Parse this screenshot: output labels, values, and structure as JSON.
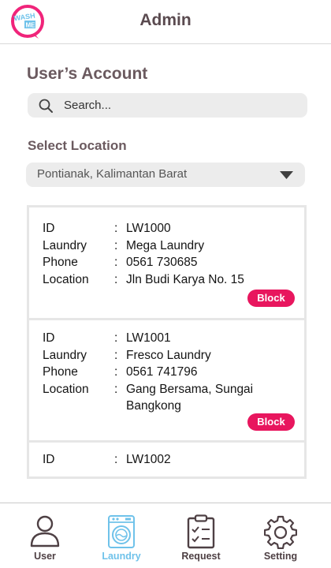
{
  "header": {
    "title": "Admin",
    "logo_text": [
      "WASH",
      "ME"
    ]
  },
  "page": {
    "section_title": "User’s Account"
  },
  "search": {
    "placeholder": "Search..."
  },
  "location": {
    "label": "Select Location",
    "selected": "Pontianak, Kalimantan Barat"
  },
  "field_labels": {
    "id": "ID",
    "laundry": "Laundry",
    "phone": "Phone",
    "location": "Location",
    "colon": ":"
  },
  "accounts": [
    {
      "id": "LW1000",
      "laundry": "Mega Laundry",
      "phone": "0561 730685",
      "location": "Jln Budi Karya No. 15",
      "action_label": "Block"
    },
    {
      "id": "LW1001",
      "laundry": "Fresco Laundry",
      "phone": "0561 741796",
      "location": "Gang Bersama, Sungai Bangkong",
      "action_label": "Block"
    },
    {
      "id": "LW1002"
    }
  ],
  "nav": {
    "items": [
      {
        "label": "User",
        "icon": "user-icon",
        "active": false
      },
      {
        "label": "Laundry",
        "icon": "washing-machine-icon",
        "active": true
      },
      {
        "label": "Request",
        "icon": "clipboard-check-icon",
        "active": false
      },
      {
        "label": "Setting",
        "icon": "gear-icon",
        "active": false
      }
    ]
  },
  "colors": {
    "accent": "#e8165e",
    "active_nav": "#6fc2ea",
    "title_text": "#6b5a5f",
    "logo_pink": "#f0247a",
    "logo_blue": "#6fc2ea"
  }
}
